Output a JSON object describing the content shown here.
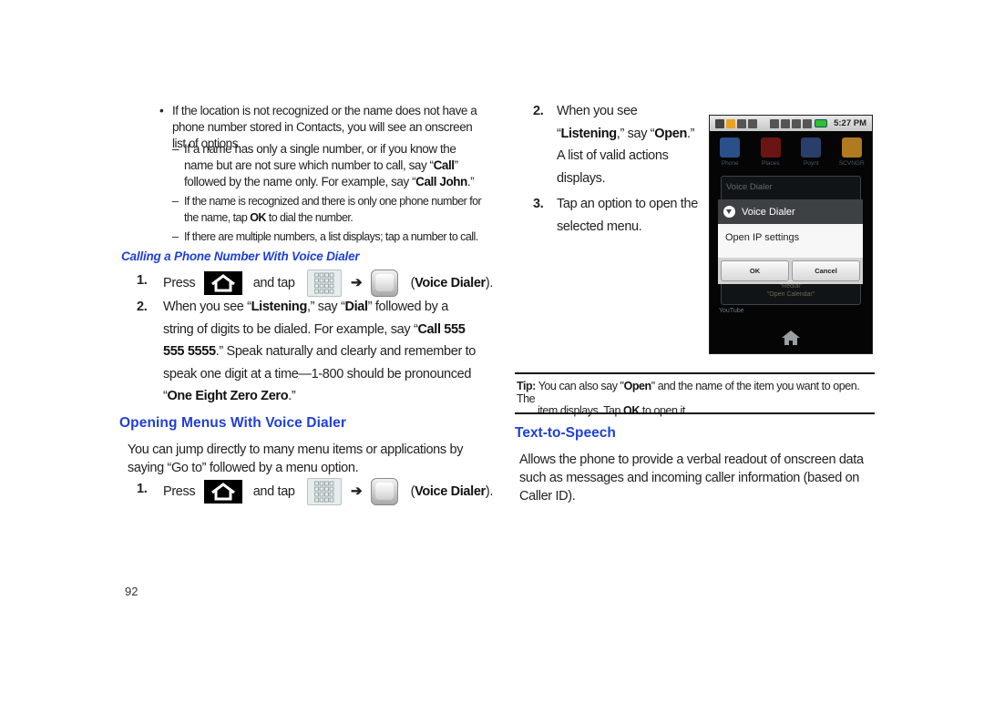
{
  "left": {
    "bullet": "If the location is not recognized or the name does not have a phone number stored in Contacts, you will see an onscreen list of options.",
    "dash1": {
      "a": "If a name has only a single number, or if you know the name but are not sure which number to call, say “",
      "b1": "Call",
      "c": "” followed by the name only. For example, say “",
      "b2": "Call John",
      "d": ".”"
    },
    "dash2": {
      "a": "If the name is recognized and there is only one phone number for the name, tap ",
      "b": "OK",
      "c": " to dial the number."
    },
    "dash3": "If there are multiple numbers, a list displays; tap a number to call.",
    "dash_marker": "–",
    "bullet_marker": "•",
    "subheading": "Calling a Phone Number With Voice Dialer",
    "steps": [
      {
        "num": "1.",
        "press": "Press",
        "and_tap": "and tap",
        "arrow": "➔",
        "open": "(",
        "bold": "Voice Dialer",
        "close": ")."
      },
      {
        "num": "2.",
        "t1": "When you see “",
        "b1": "Listening",
        "t2": ",” say “",
        "b2": "Dial",
        "t3": "” followed by a string of digits to be dialed. For example, say “",
        "b3": "Call 555 555 5555",
        "t4": ".” Speak naturally and clearly and remember to speak one digit at a time—1-800 should be pronounced “",
        "b4": "One Eight Zero Zero",
        "t5": ".”"
      }
    ],
    "heading2": "Opening Menus With Voice Dialer",
    "intro": "You can jump directly to many menu items or applications by saying “Go to” followed by a menu option.",
    "step_open": {
      "num": "1.",
      "press": "Press",
      "and_tap": "and tap",
      "arrow": "➔",
      "open": "(",
      "bold": "Voice Dialer",
      "close": ")."
    },
    "page_number": "92"
  },
  "right": {
    "steps": [
      {
        "num": "2.",
        "t1": "When you see “",
        "b1": "Listening",
        "t2": ",” say “",
        "b2": "Open",
        "t3": ".”",
        "t4": "A list of valid actions displays."
      },
      {
        "num": "3.",
        "t1": "Tap an option to open the selected menu."
      }
    ],
    "phone": {
      "status_time": "5:27 PM",
      "apps": [
        {
          "label": "Phone",
          "color": "#2b4f8a"
        },
        {
          "label": "Places",
          "color": "#6b1414"
        },
        {
          "label": "Poynt",
          "color": "#2a3e6c"
        },
        {
          "label": "SCVNGR",
          "color": "#b07a20"
        }
      ],
      "bg_dialog_title": "Voice Dialer",
      "dialog_title": "Voice Dialer",
      "dialog_body": "Open IP settings",
      "ok": "OK",
      "cancel": "Cancel",
      "dim_line1": "\"Redial\"",
      "dim_line2": "\"Open Calendar\"",
      "youtube": "YouTube"
    },
    "tip": {
      "label": "Tip:",
      "t1": " You can also say \"",
      "b1": "Open",
      "t2": "\" and the name of the item you want to open. The",
      "t3": "item displays. Tap ",
      "b2": "OK",
      "t4": " to open it."
    },
    "heading": "Text-to-Speech",
    "para": "Allows the phone to provide a verbal readout of onscreen data such as messages and incoming caller information (based on Caller ID)."
  },
  "colors": {
    "heading_blue": "#1f3fd8",
    "text": "#222222"
  }
}
